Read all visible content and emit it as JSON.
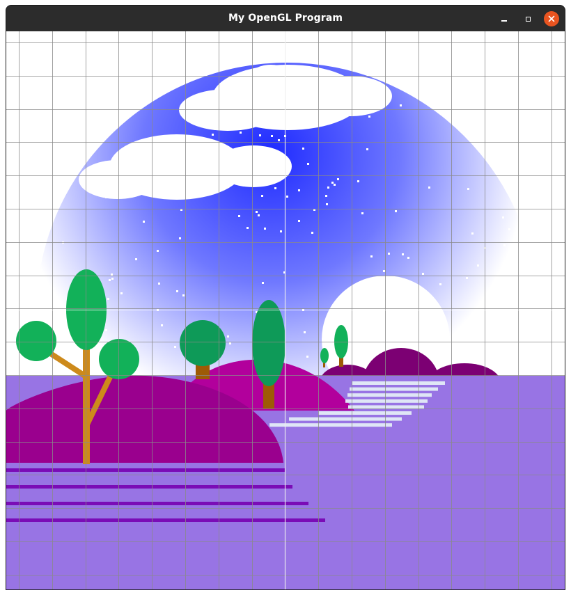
{
  "window": {
    "title": "My OpenGL Program",
    "controls": {
      "minimize_icon": "minimize-icon",
      "maximize_icon": "maximize-icon",
      "close_icon": "close-icon",
      "close_color": "#e95420"
    }
  },
  "scene": {
    "colors": {
      "sky_center": "#1f2bff",
      "sky_edge": "#ffffff",
      "ground": "#9874e4",
      "hill_front": "#9a008e",
      "hill_middle": "#b2009c",
      "hill_back": "#7c0073",
      "tree_leaves": "#12b159",
      "tree_leaves_dark": "#0e9a58",
      "trunk": "#cd8a1b",
      "trunk_dark": "#9e5a06",
      "path_stripes": "#dfe6f6",
      "ground_stripes": "#7a0cb6",
      "grid": "#8a8a8a",
      "moon": "#ffffff",
      "cloud": "#ffffff"
    },
    "grid": "on"
  }
}
